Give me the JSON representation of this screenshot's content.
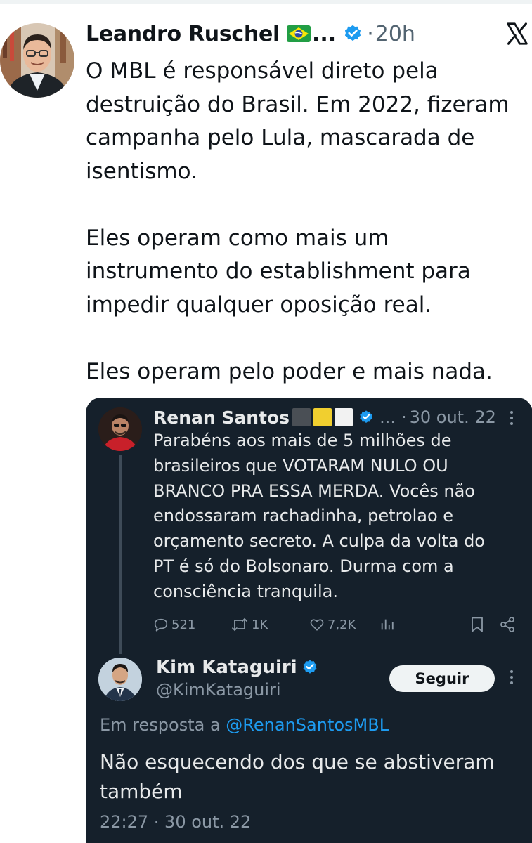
{
  "tweet": {
    "author_name": "Leandro Ruschel",
    "name_ellipsis": "...",
    "flag_icon": "brazil-flag-icon",
    "verified_icon": "verified-badge-icon",
    "separator": "·",
    "time": "20h",
    "platform_icon": "x-logo-icon",
    "text_lines": [
      "O MBL é responsável direto pela",
      "destruição do Brasil. Em 2022, fizeram",
      "campanha pelo Lula, mascarada de",
      "isentismo.",
      "Eles operam como mais um",
      "instrumento do establishment para",
      "impedir qualquer oposição real.",
      "Eles operam pelo poder e mais nada."
    ]
  },
  "quoted": {
    "original": {
      "author_name": "Renan Santos",
      "name_ellipsis": "...",
      "separator": "·",
      "date": "30 out. 22",
      "text_lines": [
        "Parabéns aos mais de 5 milhões de",
        "brasileiros que VOTARAM NULO OU",
        "BRANCO PRA ESSA MERDA. Vocês não",
        "endossaram rachadinha, petrolao e",
        "orçamento secreto. A culpa da volta do",
        "PT é só do Bolsonaro. Durma com a",
        "consciência tranquila."
      ],
      "stats": {
        "replies": "521",
        "retweets": "1K",
        "likes": "7,2K"
      }
    },
    "reply": {
      "author_name": "Kim Kataguiri",
      "handle": "@KimKataguiri",
      "follow_label": "Seguir",
      "reply_prefix": "Em resposta a",
      "reply_mention": "@RenanSantosMBL",
      "text_lines": [
        "Não esquecendo dos que se abstiveram",
        "também"
      ],
      "timestamp": "22:27 · 30 out. 22"
    }
  },
  "colors": {
    "accent": "#1d9bf0",
    "dark_bg": "#15202b",
    "muted_dark": "#8b98a5",
    "muted_light": "#536471",
    "text_dark": "#0f1419",
    "text_light": "#e7e9ea"
  }
}
